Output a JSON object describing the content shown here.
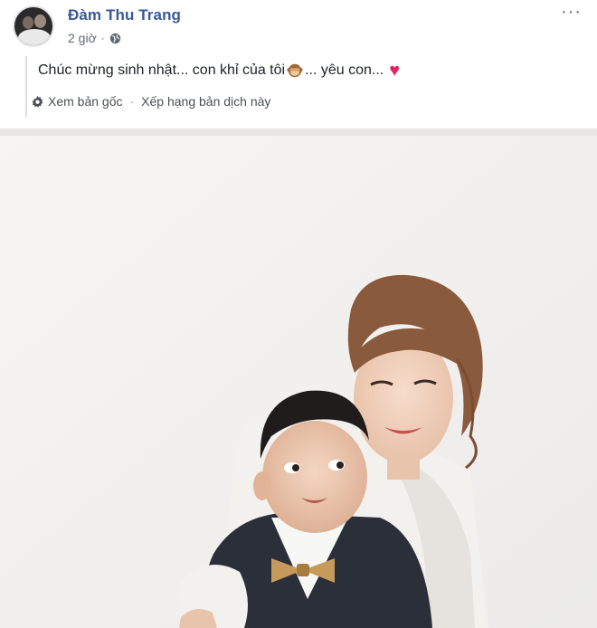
{
  "post": {
    "author": "Đàm Thu Trang",
    "time": "2 giờ",
    "separator": "·",
    "more_label": "···",
    "status_text_before": "Chúc mừng sinh nhật... con khỉ của tôi",
    "status_text_after": "... yêu con...",
    "heart_label": "♥",
    "translation": {
      "see_original": "Xem bản gốc",
      "separator": "·",
      "rate_translation": "Xếp hạng bản dịch này"
    }
  },
  "colors": {
    "name_blue": "#385898",
    "heart_red": "#e0245e",
    "meta_gray": "#606770"
  },
  "icons": {
    "globe": "globe-icon",
    "gear": "gear-icon",
    "monkey": "see-no-evil-monkey-emoji",
    "heart": "red-heart-emoji"
  }
}
